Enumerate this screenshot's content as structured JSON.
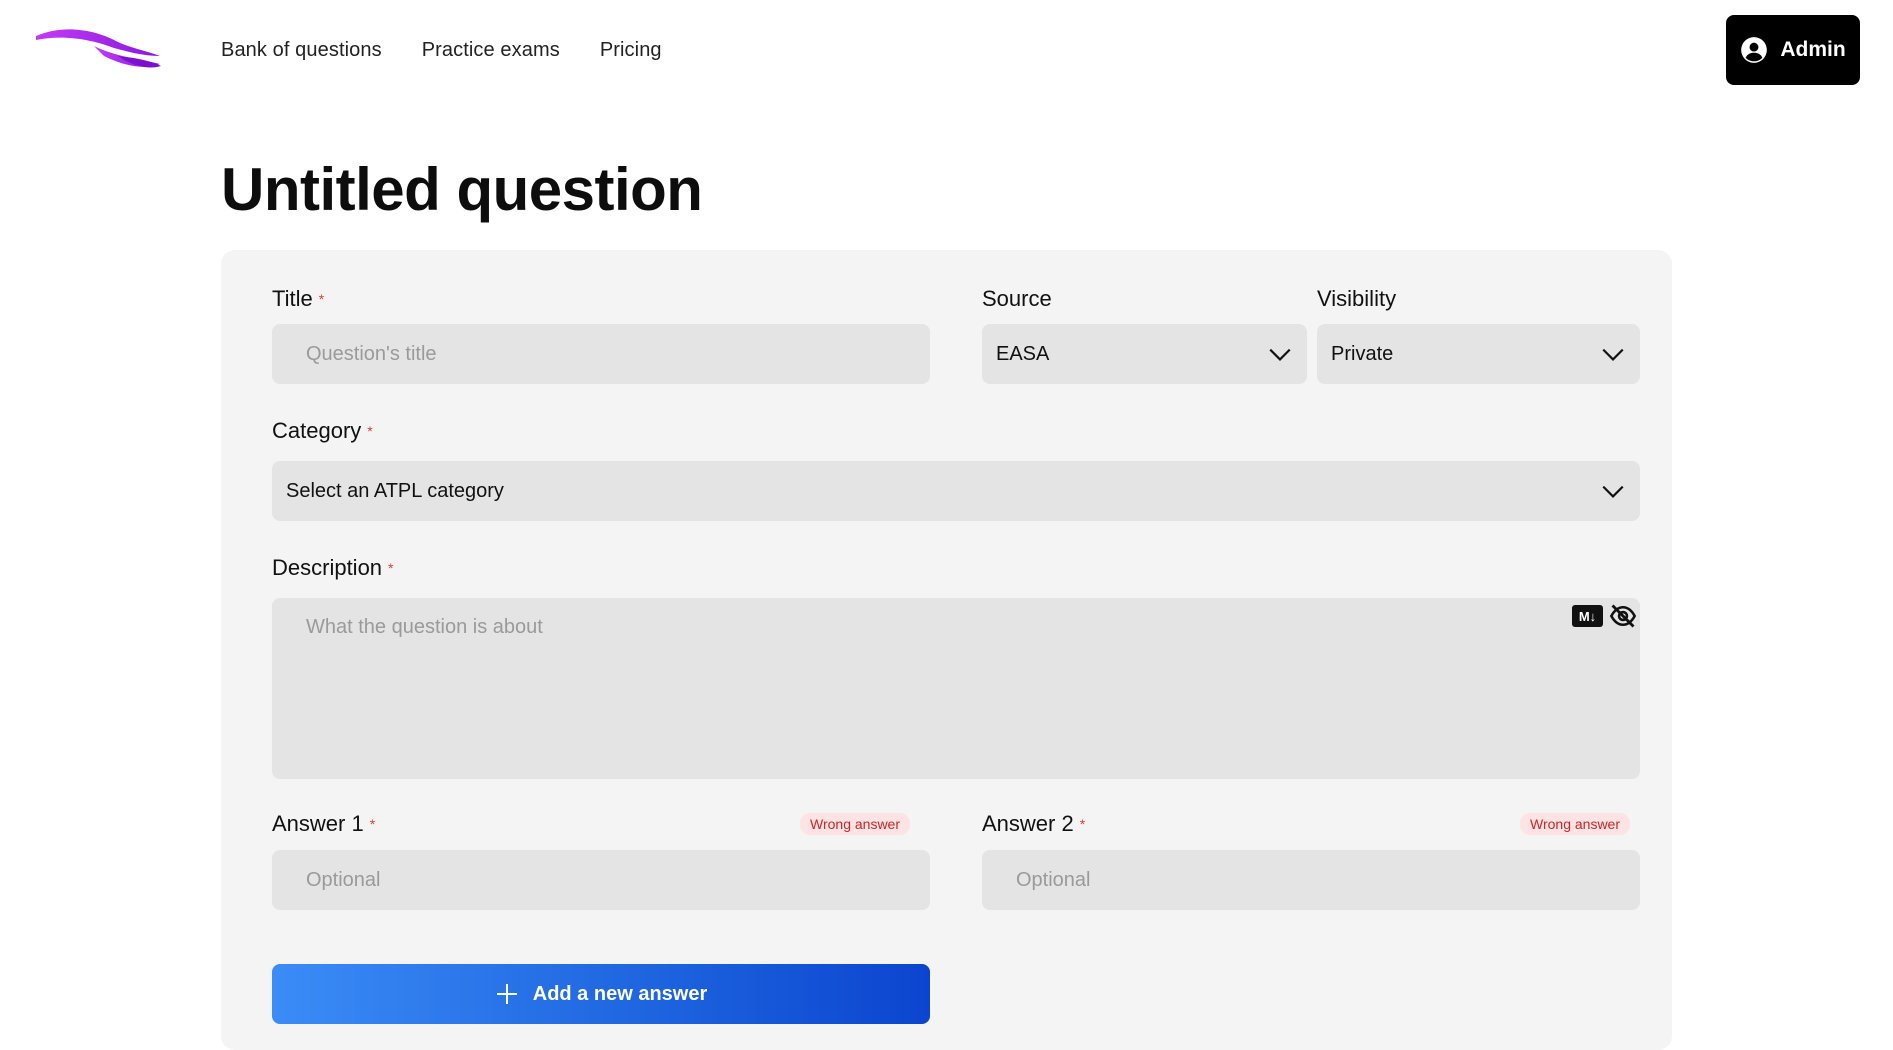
{
  "nav": {
    "logo": "logo",
    "items": [
      "Bank of questions",
      "Practice exams",
      "Pricing"
    ],
    "admin_label": "Admin"
  },
  "page_title": "Untitled question",
  "form": {
    "title": {
      "label": "Title",
      "placeholder": "Question's title",
      "value": ""
    },
    "source": {
      "label": "Source",
      "value": "EASA"
    },
    "visibility": {
      "label": "Visibility",
      "value": "Private"
    },
    "category": {
      "label": "Category",
      "value": "Select an ATPL category"
    },
    "description": {
      "label": "Description",
      "placeholder": "What the question is about",
      "value": ""
    },
    "markdown_badge": "M↓",
    "answers": [
      {
        "label": "Answer 1",
        "status": "Wrong answer",
        "placeholder": "Optional",
        "value": ""
      },
      {
        "label": "Answer 2",
        "status": "Wrong answer",
        "placeholder": "Optional",
        "value": ""
      }
    ],
    "add_answer_label": "Add a new answer"
  },
  "colors": {
    "accent_gradient_start": "#3b8cf7",
    "accent_gradient_end": "#0b45cf",
    "required": "#e53935",
    "wrong_answer_bg": "#fde3e3",
    "wrong_answer_text": "#c62828",
    "logo_purple": "#a020f0"
  },
  "icons": {
    "admin": "user-circle-icon",
    "select": "chevron-down-icon",
    "markdown": "markdown-icon",
    "preview": "eye-off-icon",
    "add": "plus-icon"
  }
}
